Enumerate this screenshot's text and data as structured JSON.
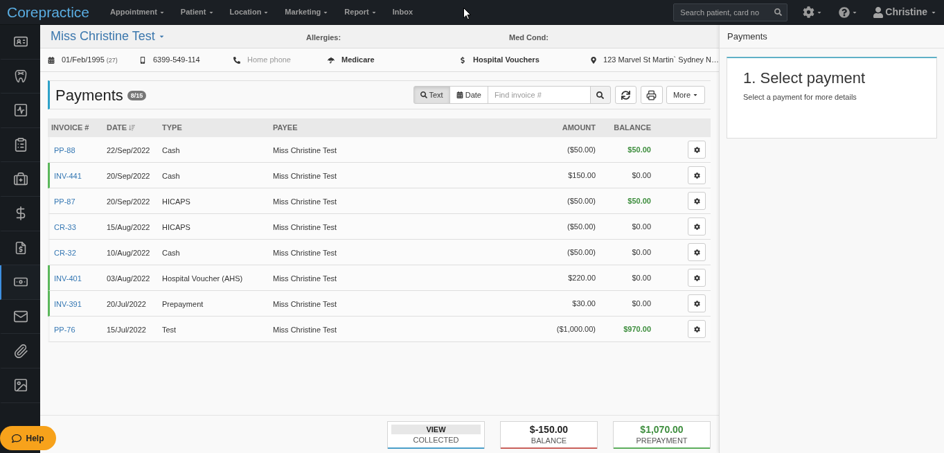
{
  "nav": {
    "logo": "Corepractice",
    "menus": [
      {
        "label": "Appointment",
        "dropdown": true
      },
      {
        "label": "Patient",
        "dropdown": true
      },
      {
        "label": "Location",
        "dropdown": true
      },
      {
        "label": "Marketing",
        "dropdown": true
      },
      {
        "label": "Report",
        "dropdown": true
      },
      {
        "label": "Inbox",
        "dropdown": false
      }
    ],
    "search": {
      "placeholder": "Search patient, card no"
    },
    "user": "Christine"
  },
  "sidebar": {
    "items": [
      {
        "selected": false
      },
      {
        "selected": false
      },
      {
        "selected": false
      },
      {
        "selected": false
      },
      {
        "selected": false
      },
      {
        "selected": false
      },
      {
        "selected": false
      },
      {
        "selected": true
      },
      {
        "selected": false
      },
      {
        "selected": false
      },
      {
        "selected": false
      }
    ]
  },
  "patient": {
    "name": "Miss Christine Test",
    "fields": [
      {
        "label": "Allergies:"
      },
      {
        "label": "Med Cond:"
      }
    ],
    "details": [
      {
        "kind": "birth_date",
        "text": "01/Feb/1995",
        "note": "(27)",
        "muted": false
      },
      {
        "kind": "mobile",
        "text": "6399-549-114",
        "muted": false
      },
      {
        "kind": "phone",
        "text": "Home phone",
        "muted": true
      },
      {
        "kind": "cover",
        "text": "Medicare",
        "muted": false
      },
      {
        "kind": "voucher",
        "text": "Hospital Vouchers",
        "muted": false
      },
      {
        "kind": "address",
        "text": "123 Marvel St Martin` Sydney N…",
        "muted": false
      }
    ]
  },
  "payments": {
    "title": "Payments",
    "count": "8/15",
    "search_modes": [
      {
        "label": "Text",
        "selected": true
      },
      {
        "label": "Date",
        "selected": false
      }
    ],
    "search": {
      "placeholder": "Find invoice #"
    },
    "more": "More",
    "columns": [
      {
        "label": "INVOICE #",
        "sorted": false
      },
      {
        "label": "DATE",
        "sorted": true
      },
      {
        "label": "TYPE",
        "sorted": false
      },
      {
        "label": "PAYEE",
        "sorted": false
      },
      {
        "label": "AMOUNT",
        "sorted": false
      },
      {
        "label": "BALANCE",
        "sorted": false
      }
    ],
    "rows": [
      {
        "invoice": "PP-88",
        "date": "22/Sep/2022",
        "type": "Cash",
        "payee": "Miss Christine Test",
        "amount": "($50.00)",
        "balance": "$50.00",
        "credit": true,
        "marked": false
      },
      {
        "invoice": "INV-441",
        "date": "20/Sep/2022",
        "type": "Cash",
        "payee": "Miss Christine Test",
        "amount": "$150.00",
        "balance": "$0.00",
        "credit": false,
        "marked": true
      },
      {
        "invoice": "PP-87",
        "date": "20/Sep/2022",
        "type": "HICAPS",
        "payee": "Miss Christine Test",
        "amount": "($50.00)",
        "balance": "$50.00",
        "credit": true,
        "marked": false
      },
      {
        "invoice": "CR-33",
        "date": "15/Aug/2022",
        "type": "HICAPS",
        "payee": "Miss Christine Test",
        "amount": "($50.00)",
        "balance": "$0.00",
        "credit": false,
        "marked": false
      },
      {
        "invoice": "CR-32",
        "date": "10/Aug/2022",
        "type": "Cash",
        "payee": "Miss Christine Test",
        "amount": "($50.00)",
        "balance": "$0.00",
        "credit": false,
        "marked": false
      },
      {
        "invoice": "INV-401",
        "date": "03/Aug/2022",
        "type": "Hospital Voucher (AHS)",
        "payee": "Miss Christine Test",
        "amount": "$220.00",
        "balance": "$0.00",
        "credit": false,
        "marked": true
      },
      {
        "invoice": "INV-391",
        "date": "20/Jul/2022",
        "type": "Prepayment",
        "payee": "Miss Christine Test",
        "amount": "$30.00",
        "balance": "$0.00",
        "credit": false,
        "marked": true
      },
      {
        "invoice": "PP-76",
        "date": "15/Jul/2022",
        "type": "Test",
        "payee": "Miss Christine Test",
        "amount": "($1,000.00)",
        "balance": "$970.00",
        "credit": true,
        "marked": false
      }
    ]
  },
  "summary": [
    {
      "kind": "button",
      "label": "VIEW",
      "caption": "COLLECTED",
      "color": "#4a9fc9"
    },
    {
      "kind": "amount",
      "label": "$-150.00",
      "caption": "BALANCE",
      "color": "#c9605a"
    },
    {
      "kind": "credit",
      "label": "$1,070.00",
      "caption": "PREPAYMENT",
      "color": "#5cae5c"
    }
  ],
  "detail_panel": {
    "title": "Payments",
    "heading": "1. Select payment",
    "hint": "Select a payment for more details"
  },
  "help": {
    "label": "Help"
  }
}
